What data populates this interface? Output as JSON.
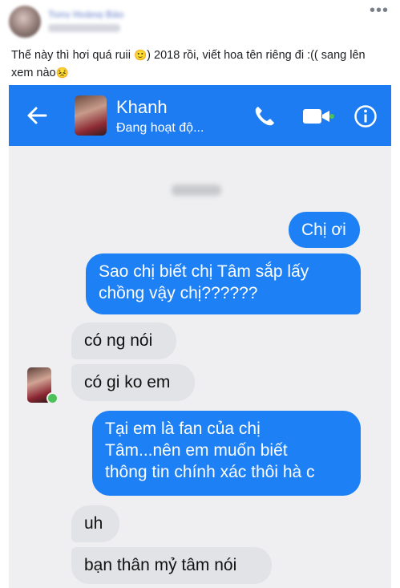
{
  "post": {
    "author": "Tony Hoàng Bảo",
    "more_icon": "more-dots-icon",
    "caption_line1": "Thế này thì hơi quá ruii",
    "caption_emoji1": "🙂",
    "caption_line1b": ") 2018 rồi, viết hoa tên riêng đi :(( sang lên",
    "caption_line2": "xem nào",
    "caption_emoji2": "😣"
  },
  "chat": {
    "contact_name": "Khanh",
    "contact_status": "Đang hoạt độ...",
    "icons": [
      "back-arrow-icon",
      "phone-icon",
      "video-camera-icon",
      "info-icon"
    ],
    "accent": "#1d7cf2",
    "messages": [
      {
        "side": "out",
        "text": "Chị ơi"
      },
      {
        "side": "out",
        "lines": [
          "Sao chị biết chị Tâm sắp lấy",
          "chồng vậy chị??????"
        ]
      },
      {
        "side": "in",
        "text": "có ng nói"
      },
      {
        "side": "in",
        "text": "có gi ko em"
      },
      {
        "side": "out",
        "lines": [
          "Tại em là fan của chị",
          "Tâm...nên em muốn biết",
          "thông tin chính xác thôi hà c"
        ]
      },
      {
        "side": "in",
        "text": "uh"
      },
      {
        "side": "in",
        "text": "bạn thân mỷ tâm nói"
      }
    ]
  }
}
